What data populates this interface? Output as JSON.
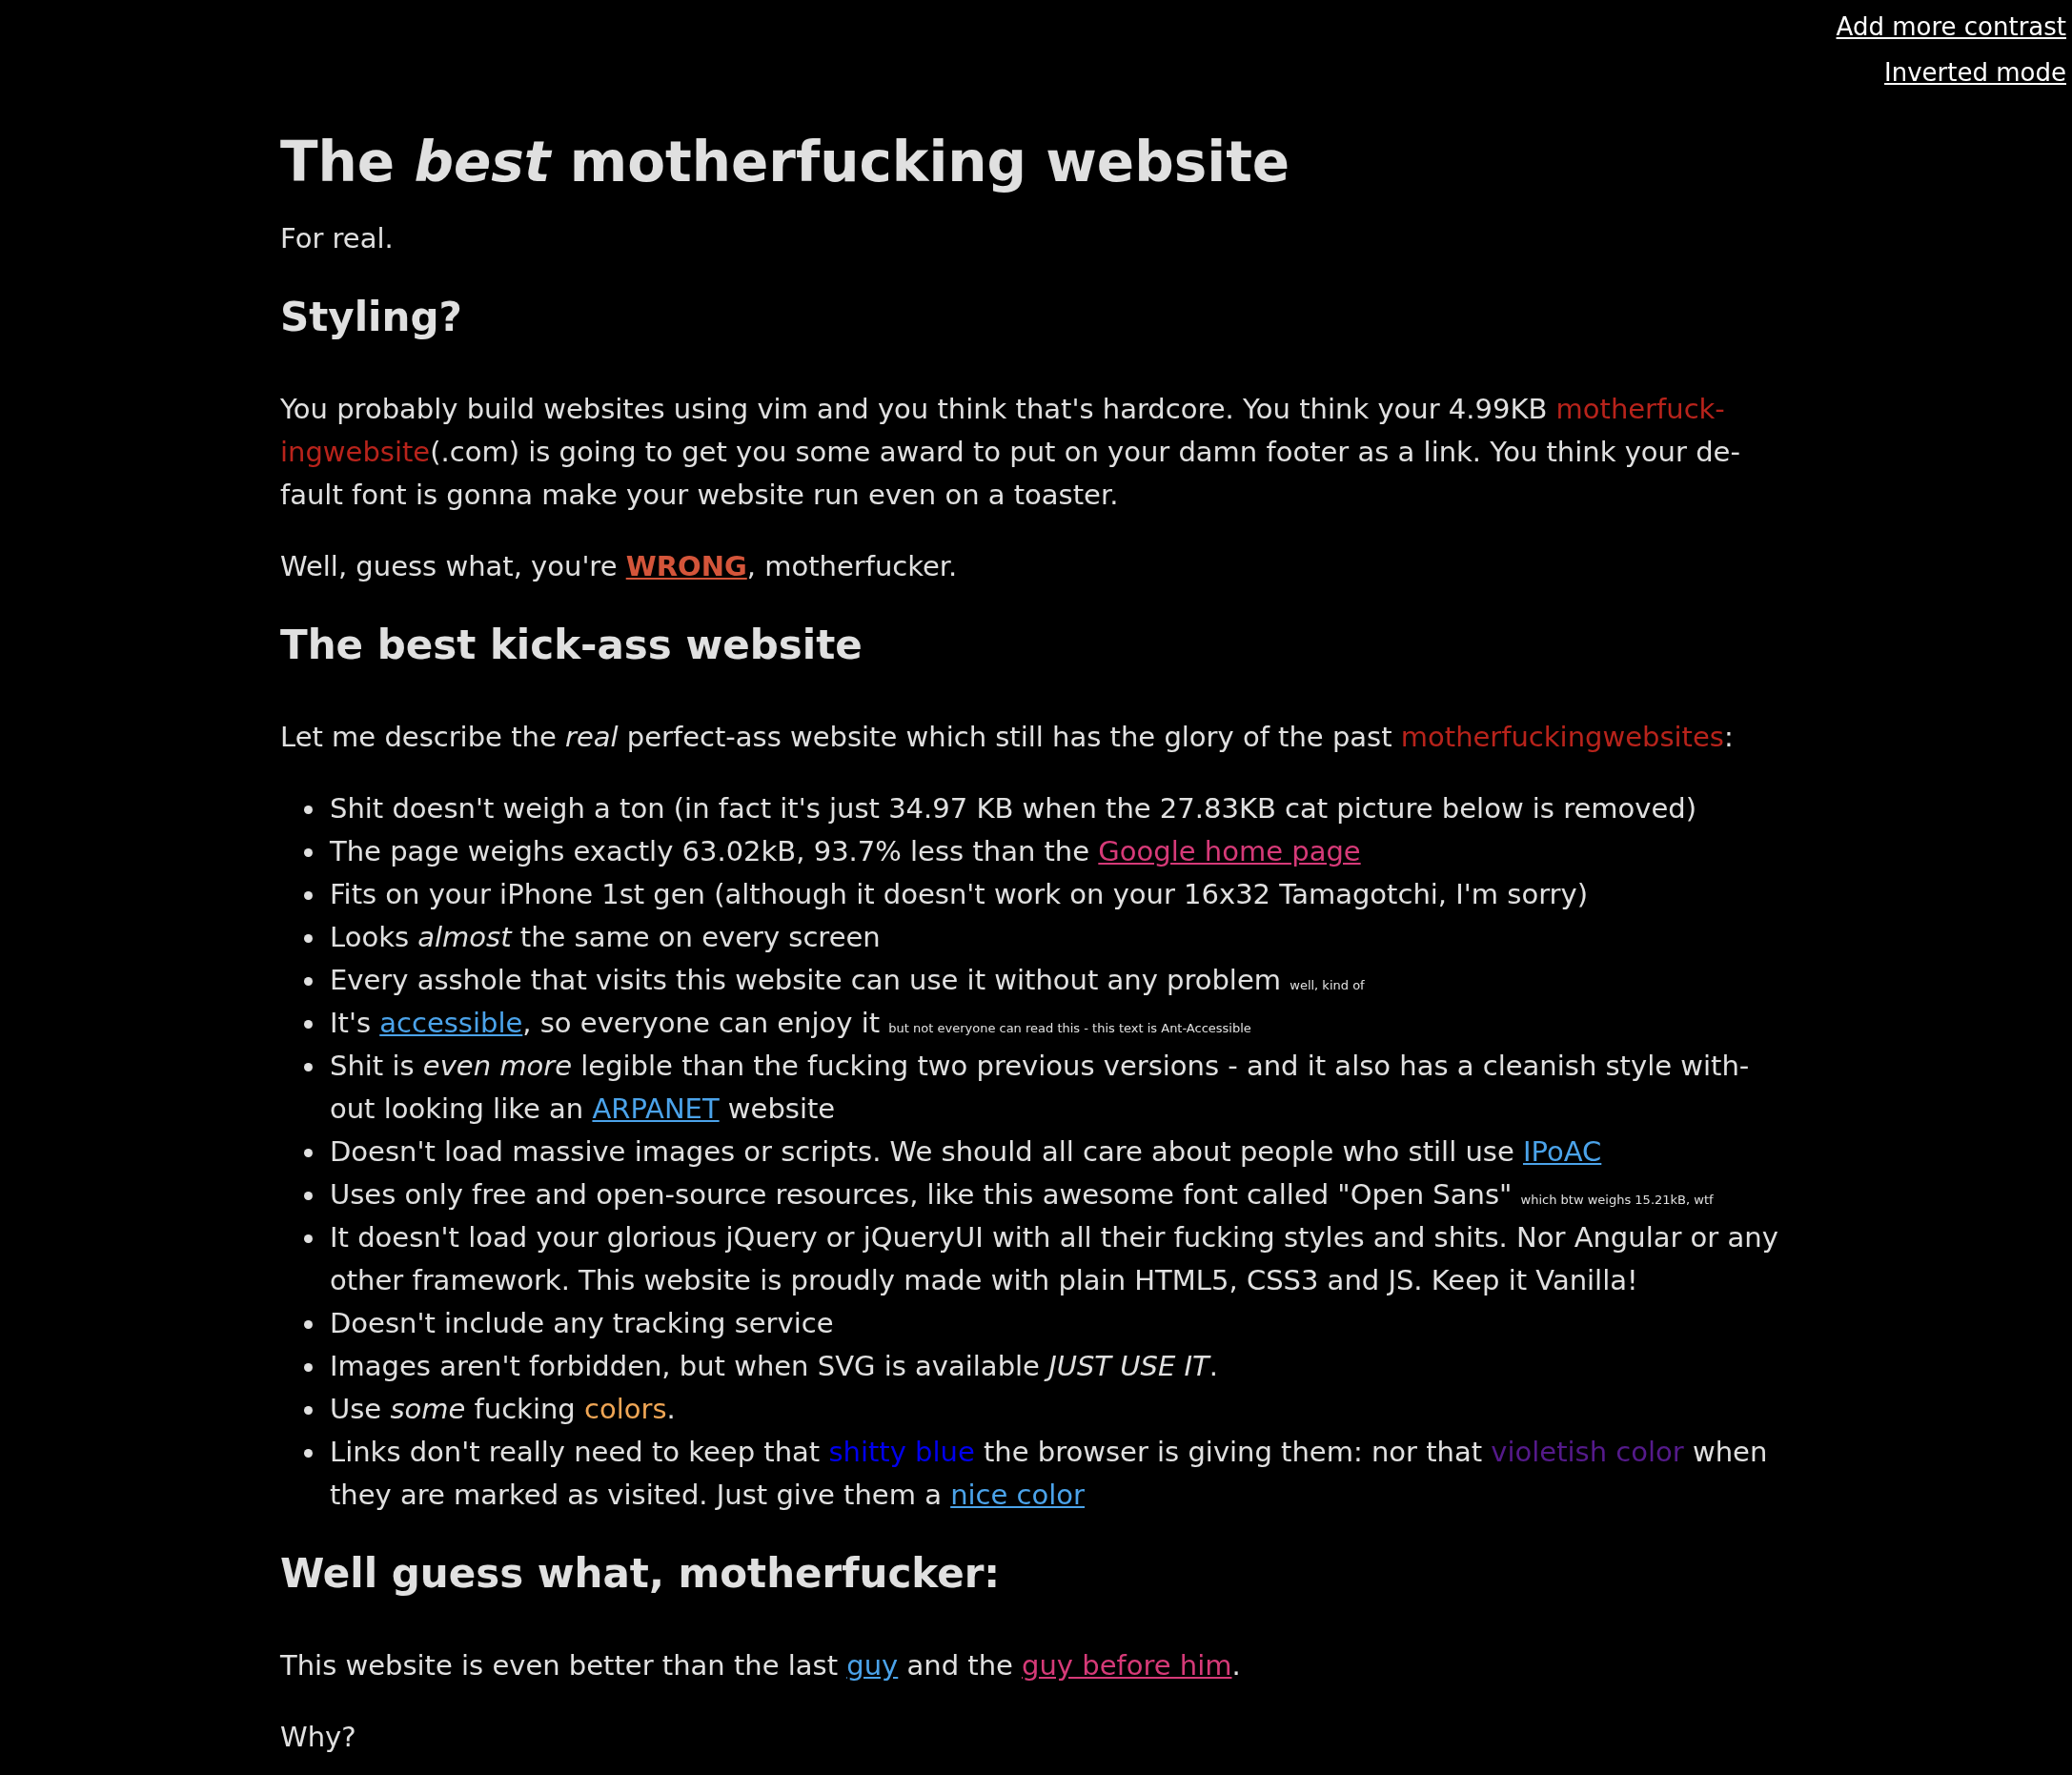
{
  "corner_links": [
    {
      "text": "Add more contrast"
    },
    {
      "text": "Inverted mode"
    }
  ],
  "title": "The *best* motherfucking website",
  "subtitle": "For real.",
  "sections": [
    {
      "heading": "Styling?",
      "blocks": [
        {
          "kind": "paragraph",
          "segments": [
            {
              "kind": "text",
              "text": "You probably build websites using vim and you think that's hardcore. You think your 4.99KB "
            },
            {
              "kind": "link",
              "text": "motherfuck-",
              "color": "#b8231b",
              "underline": false
            },
            {
              "kind": "link",
              "text": "ingwebsite",
              "color": "#b8231b",
              "underline": false
            },
            {
              "kind": "text",
              "text": "(.com) is going to get you some award to put on your damn footer as a link. You think your de-fault font is gonna make your website run even on a toaster."
            }
          ]
        },
        {
          "kind": "paragraph",
          "segments": [
            {
              "kind": "text",
              "text": "Well, guess what, you're "
            },
            {
              "kind": "link",
              "text": "WRONG",
              "color": "#d4553a",
              "underline": true,
              "bold": true
            },
            {
              "kind": "text",
              "text": ", motherfucker."
            }
          ]
        }
      ]
    },
    {
      "heading": "The best kick-ass website",
      "blocks": [
        {
          "kind": "paragraph",
          "segments": [
            {
              "kind": "text",
              "text": "Let me describe the *real* perfect-ass website which still has the glory of the past "
            },
            {
              "kind": "link",
              "text": "motherfuckingwebsites",
              "color": "#b8231b",
              "underline": false
            },
            {
              "kind": "text",
              "text": ":"
            }
          ]
        },
        {
          "kind": "list",
          "items": [
            {
              "segments": [
                {
                  "kind": "text",
                  "text": "Shit doesn't weigh a ton (in fact it's just 34.97 KB when the 27.83KB cat picture below is removed)"
                }
              ]
            },
            {
              "segments": [
                {
                  "kind": "text",
                  "text": "The page weighs exactly 63.02kB, 93.7% less than the "
                },
                {
                  "kind": "link",
                  "text": "Google home page",
                  "color": "#d63a78",
                  "underline": true
                }
              ]
            },
            {
              "segments": [
                {
                  "kind": "text",
                  "text": "Fits on your iPhone 1st gen (although it doesn't work on your 16x32 Tamagotchi, I'm sorry)"
                }
              ]
            },
            {
              "segments": [
                {
                  "kind": "text",
                  "text": "Looks *almost* the same on every screen"
                }
              ]
            },
            {
              "segments": [
                {
                  "kind": "text",
                  "text": "Every asshole that visits this website can use it without any problem "
                },
                {
                  "kind": "note",
                  "text": "well, kind of"
                }
              ]
            },
            {
              "segments": [
                {
                  "kind": "text",
                  "text": "It's "
                },
                {
                  "kind": "link",
                  "text": "accessible",
                  "color": "#4ba3ea",
                  "underline": true
                },
                {
                  "kind": "text",
                  "text": ", so everyone can enjoy it "
                },
                {
                  "kind": "note",
                  "text": "but not everyone can read this - this text is Ant-Accessible"
                }
              ]
            },
            {
              "segments": [
                {
                  "kind": "text",
                  "text": "Shit is *even more* legible than the fucking two previous versions - and it also has a cleanish style with-out looking like an "
                },
                {
                  "kind": "link",
                  "text": "ARPANET",
                  "color": "#4ba3ea",
                  "underline": true
                },
                {
                  "kind": "text",
                  "text": " website"
                }
              ]
            },
            {
              "segments": [
                {
                  "kind": "text",
                  "text": "Doesn't load massive images or scripts. We should all care about people who still use "
                },
                {
                  "kind": "link",
                  "text": "IPoAC",
                  "color": "#4ba3ea",
                  "underline": true
                }
              ]
            },
            {
              "segments": [
                {
                  "kind": "text",
                  "text": "Uses only free and open-source resources, like this awesome font called \"Open Sans\" "
                },
                {
                  "kind": "note",
                  "text": "which btw weighs 15.21kB, wtf"
                }
              ]
            },
            {
              "segments": [
                {
                  "kind": "text",
                  "text": "It doesn't load your glorious jQuery or jQueryUI with all their fucking styles and shits. Nor Angular or any other framework. This website is proudly made with plain HTML5, CSS3 and JS. Keep it Vanilla!"
                }
              ]
            },
            {
              "segments": [
                {
                  "kind": "text",
                  "text": "Doesn't include any tracking service"
                }
              ]
            },
            {
              "segments": [
                {
                  "kind": "text",
                  "text": "Images aren't forbidden, but when SVG is available *JUST USE IT*."
                }
              ]
            },
            {
              "segments": [
                {
                  "kind": "text",
                  "text": "Use *some* fucking "
                },
                {
                  "kind": "colored",
                  "text": "colors",
                  "color": "#f0a655"
                },
                {
                  "kind": "text",
                  "text": "."
                }
              ]
            },
            {
              "segments": [
                {
                  "kind": "text",
                  "text": "Links don't really need to keep that "
                },
                {
                  "kind": "colored",
                  "text": "shitty blue",
                  "color": "#0000ee"
                },
                {
                  "kind": "text",
                  "text": " the browser is giving them: nor that "
                },
                {
                  "kind": "colored",
                  "text": "violetish color",
                  "color": "#551a8b"
                },
                {
                  "kind": "text",
                  "text": " when they are marked as visited. Just give them a "
                },
                {
                  "kind": "link",
                  "text": "nice color",
                  "color": "#4ba3ea",
                  "underline": true
                }
              ]
            }
          ]
        }
      ]
    },
    {
      "heading": "Well guess what, motherfucker:",
      "blocks": [
        {
          "kind": "paragraph",
          "segments": [
            {
              "kind": "text",
              "text": "This website is even better than the last "
            },
            {
              "kind": "link",
              "text": "guy",
              "color": "#4ba3ea",
              "underline": true
            },
            {
              "kind": "text",
              "text": " and the "
            },
            {
              "kind": "link",
              "text": "guy before him",
              "color": "#d63a78",
              "underline": true
            },
            {
              "kind": "text",
              "text": "."
            }
          ]
        },
        {
          "kind": "paragraph",
          "segments": [
            {
              "kind": "text",
              "text": "Why?"
            }
          ]
        }
      ]
    }
  ]
}
